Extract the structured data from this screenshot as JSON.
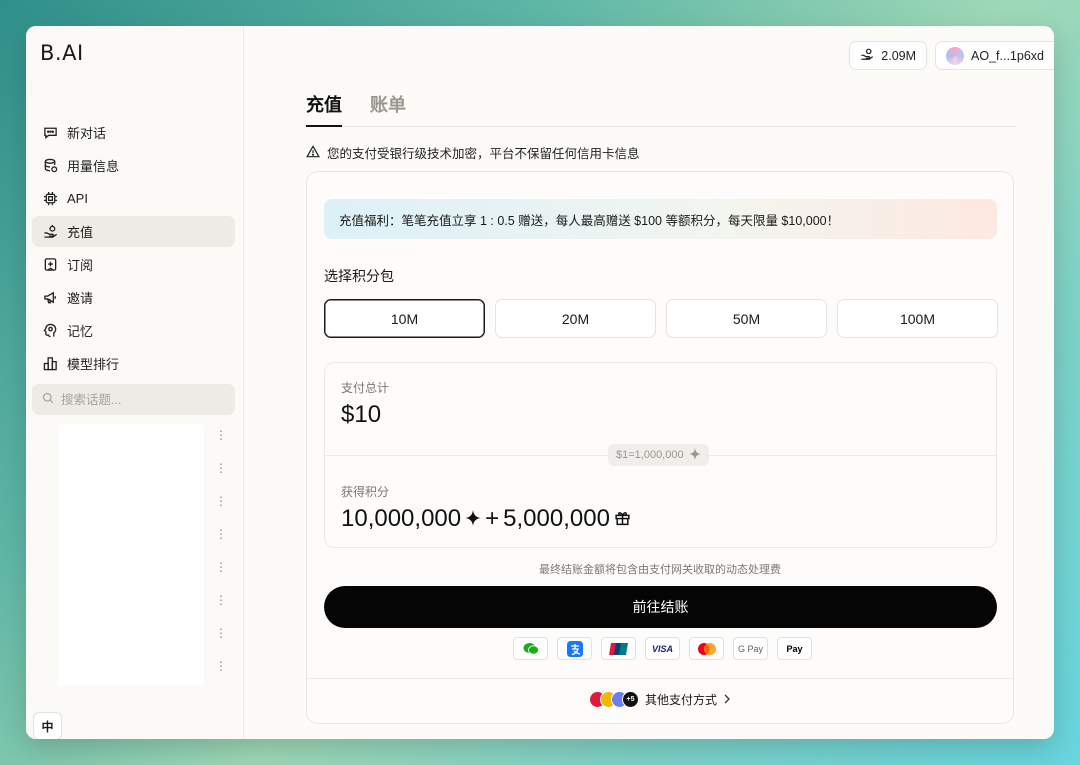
{
  "app": {
    "logo_text": "B.AI"
  },
  "sidebar": {
    "items": [
      {
        "label": "新对话",
        "icon": "chat-bubble-icon"
      },
      {
        "label": "用量信息",
        "icon": "database-icon"
      },
      {
        "label": "API",
        "icon": "chip-icon"
      },
      {
        "label": "充值",
        "icon": "hand-coin-icon",
        "active": true
      },
      {
        "label": "订阅",
        "icon": "bookmark-plus-icon"
      },
      {
        "label": "邀请",
        "icon": "megaphone-icon"
      },
      {
        "label": "记忆",
        "icon": "brain-icon"
      },
      {
        "label": "模型排行",
        "icon": "bar-chart-icon"
      }
    ],
    "search_placeholder": "搜索话题...",
    "history_menu_count": 8,
    "lang_button": "中"
  },
  "topbar": {
    "credits": "2.09M",
    "account": "AO_f...1p6xd"
  },
  "tabs": [
    {
      "label": "充值",
      "active": true
    },
    {
      "label": "账单",
      "active": false
    }
  ],
  "notice": "您的支付受银行级技术加密，平台不保留任何信用卡信息",
  "promo": "充值福利：笔笔充值立享 1 : 0.5 赠送，每人最高赠送 $100 等额积分，每天限量 $10,000！",
  "package_section": {
    "title": "选择积分包",
    "packages": [
      "10M",
      "20M",
      "50M",
      "100M"
    ],
    "selected": "10M"
  },
  "summary": {
    "total_label": "支付总计",
    "total_value": "$10",
    "rate": "$1=1,000,000",
    "credits_label": "获得积分",
    "credits_base": "10,000,000",
    "credits_plus": "+",
    "credits_bonus": "5,000,000"
  },
  "fee_note": "最终结账金额将包含由支付网关收取的动态处理费",
  "checkout_label": "前往结账",
  "payment_methods": [
    "wechat-pay-icon",
    "alipay-icon",
    "unionpay-icon",
    "visa-icon",
    "mastercard-icon",
    "google-pay-icon",
    "apple-pay-icon"
  ],
  "payment_labels": {
    "visa": "VISA",
    "gpay": "G Pay",
    "applepay": "Pay"
  },
  "other_pay": {
    "label": "其他支付方式",
    "badge": "+5"
  },
  "colors": {
    "accent": "#050505",
    "promo_start": "#dcf1f8",
    "promo_end": "#fde9e1"
  }
}
